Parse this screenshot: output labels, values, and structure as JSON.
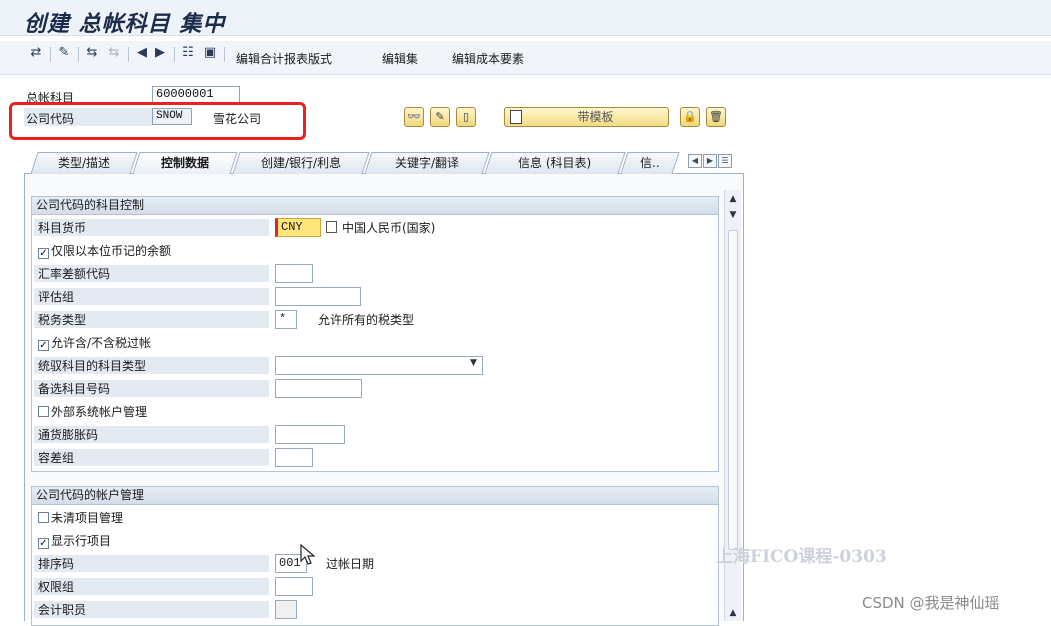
{
  "window": {
    "title": "创建 总帐科目 集中"
  },
  "toolbar": {
    "items": [
      "编辑合计报表版式",
      "编辑集",
      "编辑成本要素"
    ],
    "icons": [
      "switch-icon",
      "display-change-icon",
      "other-icon",
      "disabled-icon",
      "prev-icon",
      "next-icon",
      "where-used-icon",
      "document-icon"
    ]
  },
  "header": {
    "gl_account_label": "总帐科目",
    "gl_account_value": "60000001",
    "company_code_label": "公司代码",
    "company_code_value": "SNOW",
    "company_name": "雪花公司",
    "template_button": "带模板",
    "icons": [
      "glasses-icon",
      "pencil-icon",
      "new-doc-icon",
      "lock-icon",
      "trash-icon"
    ]
  },
  "tabs": {
    "items": [
      "类型/描述",
      "控制数据",
      "创建/银行/利息",
      "关键字/翻译",
      "信息 (科目表)",
      "信.."
    ],
    "active": "控制数据"
  },
  "group1": {
    "title": "公司代码的科目控制",
    "currency_label": "科目货币",
    "currency_value": "CNY",
    "currency_text": "中国人民币(国家)",
    "local_currency_only": "仅限以本位币记的余额",
    "exchange_diff_label": "汇率差额代码",
    "valuation_group_label": "评估组",
    "tax_category_label": "税务类型",
    "tax_category_value": "*",
    "tax_category_text": "允许所有的税类型",
    "posting_without_tax": "允许含/不含税过帐",
    "recon_account_label": "统驭科目的科目类型",
    "alt_account_label": "备选科目号码",
    "external_mgmt": "外部系统帐户管理",
    "inflation_key_label": "通货膨胀码",
    "tolerance_group_label": "容差组"
  },
  "group2": {
    "title": "公司代码的帐户管理",
    "open_item_mgmt": "未清项目管理",
    "line_item_display": "显示行项目",
    "sort_key_label": "排序码",
    "sort_key_value": "001",
    "sort_key_text": "过帐日期",
    "auth_group_label": "权限组",
    "accounting_clerk_label": "会计职员"
  },
  "checkbox_states": {
    "local_currency_only": true,
    "posting_without_tax": true,
    "external_mgmt": false,
    "open_item_mgmt": false,
    "line_item_display": true
  },
  "watermarks": {
    "course": "上海FICO课程-0303",
    "csdn": "CSDN @我是神仙瑶"
  },
  "colors": {
    "required_field": "#ffe57a",
    "highlight_box": "#e8231f",
    "title_text": "#1c2b4a"
  }
}
